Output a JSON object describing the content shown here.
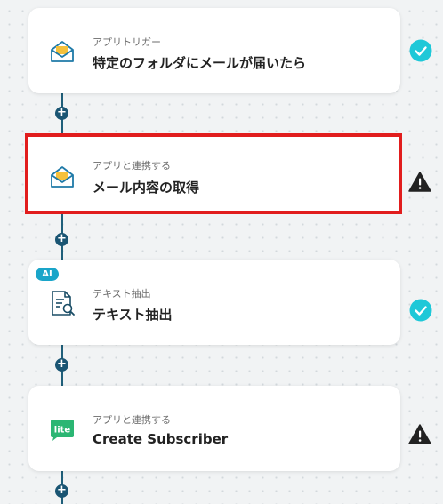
{
  "flow": {
    "steps": [
      {
        "category": "アプリトリガー",
        "title": "特定のフォルダにメールが届いたら",
        "icon": "mail-envelope-icon",
        "status": "complete",
        "selected": false
      },
      {
        "category": "アプリと連携する",
        "title": "メール内容の取得",
        "icon": "mail-envelope-icon",
        "status": "warning",
        "selected": true
      },
      {
        "category": "テキスト抽出",
        "title": "テキスト抽出",
        "icon": "document-search-icon",
        "badge": "AI",
        "status": "complete",
        "selected": false
      },
      {
        "category": "アプリと連携する",
        "title": "Create Subscriber",
        "icon": "lite-app-icon",
        "icon_text": "lite",
        "status": "warning",
        "selected": false
      }
    ],
    "add_step_symbol": "+"
  },
  "colors": {
    "connector": "#1f5f7a",
    "complete": "#1ec8d8",
    "warning": "#222222",
    "selected_border": "#e11d1d",
    "ai_badge": "#1aa5c9",
    "lite_brand": "#2bb673",
    "mail_icon": "#1f7aa8"
  }
}
